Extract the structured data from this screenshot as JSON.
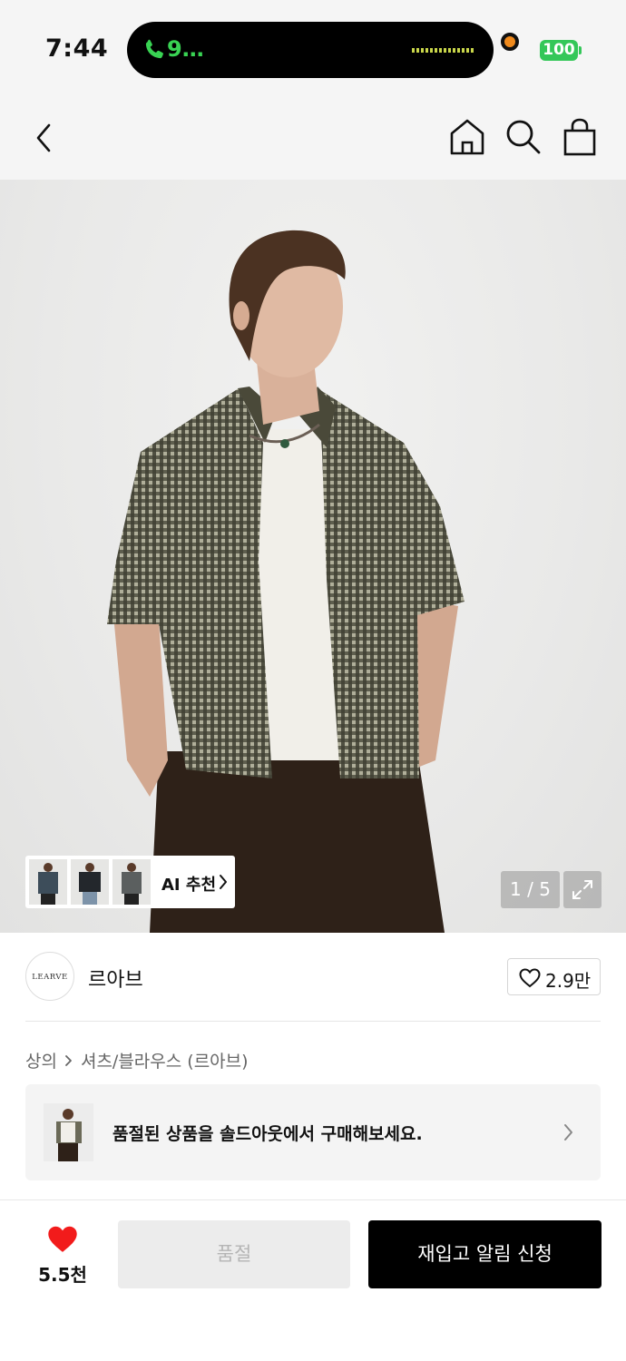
{
  "status_bar": {
    "time": "7:44",
    "call_indicator": "9…",
    "battery": "100"
  },
  "nav": {
    "back_icon": "chevron-left-icon",
    "home_icon": "home-icon",
    "search_icon": "search-icon",
    "cart_icon": "shopping-bag-icon"
  },
  "gallery": {
    "ai_label": "AI 추천",
    "counter": "1 / 5",
    "expand_icon": "expand-icon"
  },
  "brand": {
    "logo_text": "LEARVE",
    "name": "르아브",
    "likes": "2.9만"
  },
  "breadcrumb": {
    "category": "상의",
    "subcategory": "셔츠/블라우스 (르아브)"
  },
  "banner": {
    "text": "품절된 상품을 솔드아웃에서 구매해보세요."
  },
  "bottom_bar": {
    "like_count": "5.5천",
    "soldout_label": "품절",
    "restock_label": "재입고 알림 신청"
  },
  "colors": {
    "accent_heart": "#f21b1b",
    "primary_button": "#000000",
    "battery_green": "#34c759"
  }
}
